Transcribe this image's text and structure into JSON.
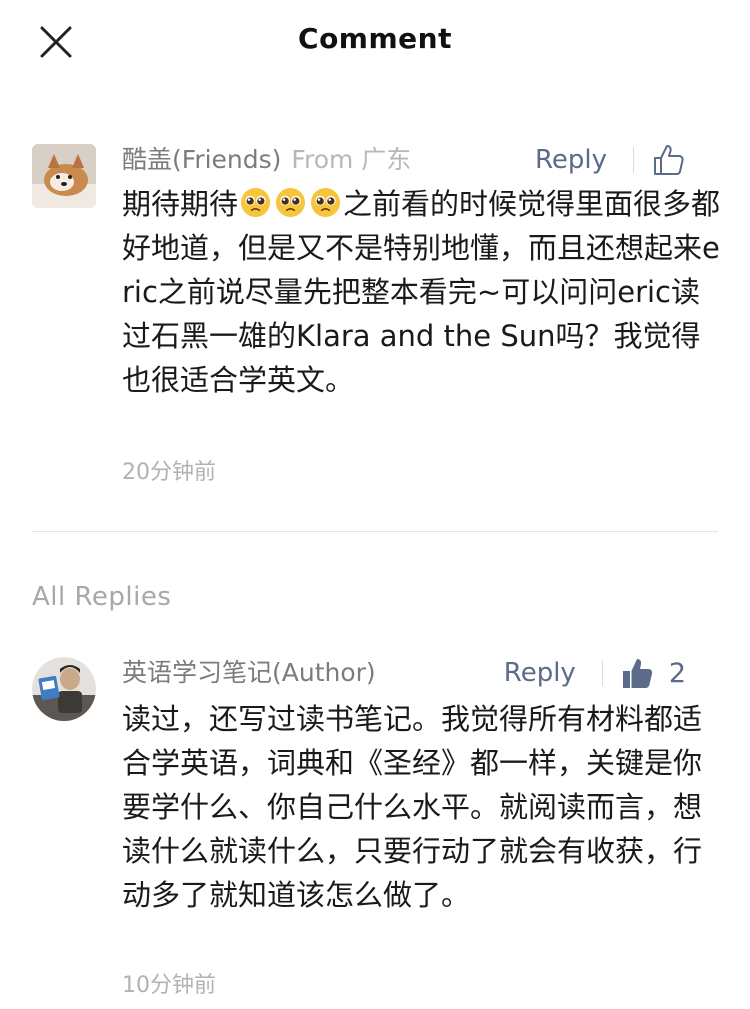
{
  "header": {
    "title": "Comment",
    "close_icon": "close-icon"
  },
  "comment": {
    "author": "酷盖(Friends)",
    "location": "From 广东",
    "reply_label": "Reply",
    "like_count": "",
    "text_before_emoji": "期待期待",
    "emoji": [
      "pleading-face",
      "pleading-face",
      "pleading-face"
    ],
    "text_after_emoji": "之前看的时候觉得里面很多都好地道，但是又不是特别地懂，而且还想起来eric之前说尽量先把整本看完~可以问问eric读过石黑一雄的Klara and the Sun吗？我觉得也很适合学英文。",
    "time": "20分钟前",
    "liked": false
  },
  "replies_section": {
    "label": "All Replies"
  },
  "reply": {
    "author": "英语学习笔记(Author)",
    "reply_label": "Reply",
    "like_count": "2",
    "liked": true,
    "text": "读过，还写过读书笔记。我觉得所有材料都适合学英语，词典和《圣经》都一样，关键是你要学什么、你自己什么水平。就阅读而言，想读什么就读什么，只要行动了就会有收获，行动多了就知道该怎么做了。",
    "time": "10分钟前"
  },
  "colors": {
    "link": "#5b6b89",
    "muted": "#7c7c7c",
    "light": "#b2b2b2",
    "text": "#1a1a1a"
  }
}
